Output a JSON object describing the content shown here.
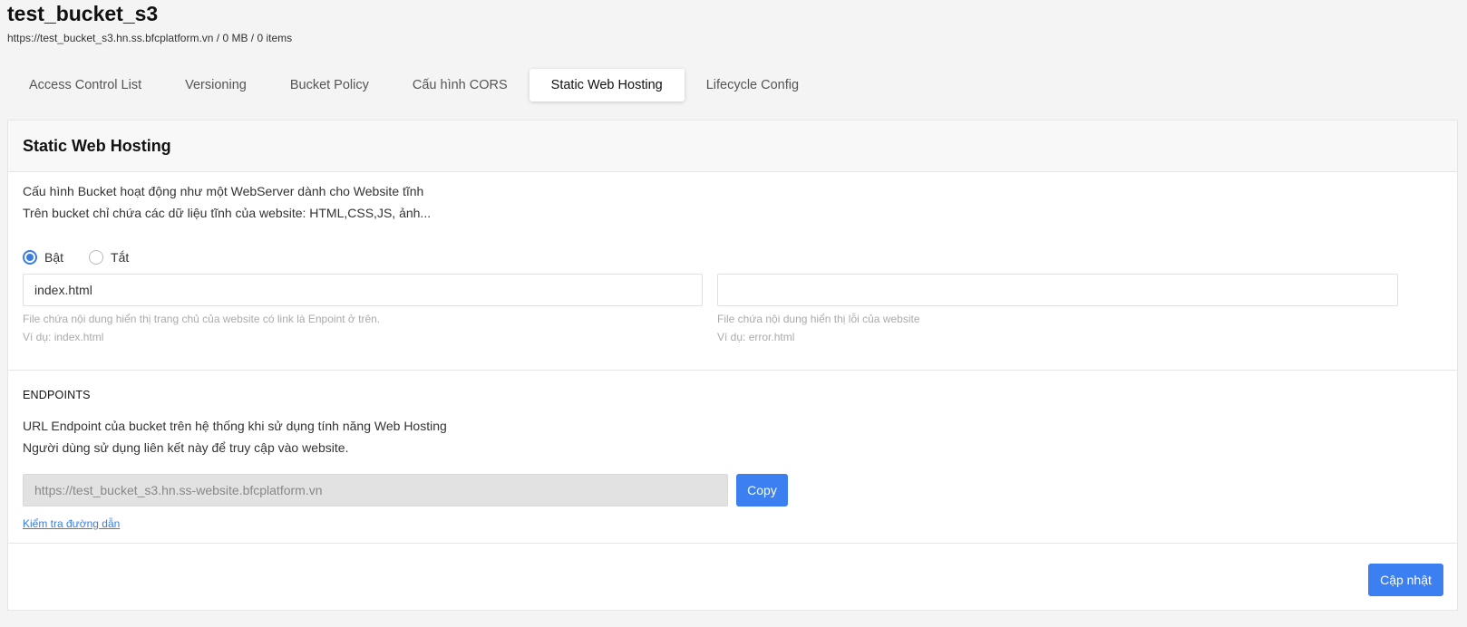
{
  "bucket": {
    "name": "test_bucket_s3",
    "info": "https://test_bucket_s3.hn.ss.bfcplatform.vn / 0 MB / 0 items"
  },
  "tabs": [
    {
      "label": "Access Control List"
    },
    {
      "label": "Versioning"
    },
    {
      "label": "Bucket Policy"
    },
    {
      "label": "Cấu hình CORS"
    },
    {
      "label": "Static Web Hosting"
    },
    {
      "label": "Lifecycle Config"
    }
  ],
  "active_tab": "Static Web Hosting",
  "panel": {
    "title": "Static Web Hosting",
    "desc_line1": "Cấu hình Bucket hoạt động như một WebServer dành cho Website tĩnh",
    "desc_line2": "Trên bucket chỉ chứa các dữ liệu tĩnh của website: HTML,CSS,JS, ảnh...",
    "radio_on": "Bật",
    "radio_off": "Tắt",
    "selected": "Bật",
    "index_doc": {
      "value": "index.html",
      "hint1": "File chứa nội dung hiển thị trang chủ của website có link là Enpoint ở trên.",
      "hint2": "Ví dụ: index.html"
    },
    "error_doc": {
      "value": "",
      "hint1": "File chứa nội dung hiển thị lỗi của website",
      "hint2": "Ví dụ: error.html"
    }
  },
  "endpoints": {
    "label": "ENDPOINTS",
    "desc_line1": "URL Endpoint của bucket trên hệ thống khi sử dụng tính năng Web Hosting",
    "desc_line2": "Người dùng sử dụng liên kết này để truy cập vào website.",
    "url": "https://test_bucket_s3.hn.ss-website.bfcplatform.vn",
    "copy_label": "Copy",
    "check_link": "Kiểm tra đường dẫn"
  },
  "footer": {
    "update_label": "Cập nhật"
  },
  "colors": {
    "accent": "#3b7ff0",
    "background": "#f4f4f4"
  }
}
